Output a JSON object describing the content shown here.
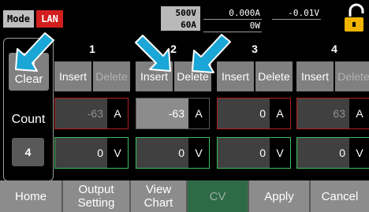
{
  "status": {
    "mode_label": "Mode",
    "interface_label": "LAN",
    "rated_voltage": "500V",
    "rated_current": "60A",
    "measured_current": "0.000A",
    "measured_voltage": "-0.01V",
    "measured_power": "0W",
    "lock_icon": "lock-open-icon"
  },
  "left_panel": {
    "all_clear_label": "All Clear",
    "count_label": "Count",
    "count_value": "4"
  },
  "columns": [
    {
      "number": "1",
      "insert": "Insert",
      "delete": "Delete",
      "current": "-63",
      "current_unit": "A",
      "voltage": "0",
      "voltage_unit": "V"
    },
    {
      "number": "2",
      "insert": "Insert",
      "delete": "Delete",
      "current": "-63",
      "current_unit": "A",
      "voltage": "0",
      "voltage_unit": "V"
    },
    {
      "number": "3",
      "insert": "Insert",
      "delete": "Delete",
      "current": "0",
      "current_unit": "A",
      "voltage": "0",
      "voltage_unit": "V"
    },
    {
      "number": "4",
      "insert": "Insert",
      "delete": "Delete",
      "current": "63",
      "current_unit": "A",
      "voltage": "0",
      "voltage_unit": "V"
    }
  ],
  "softkeys": {
    "home": "Home",
    "output_setting": "Output Setting",
    "view_chart": "View Chart",
    "cv": "CV",
    "apply": "Apply",
    "cancel": "Cancel"
  },
  "colors": {
    "lan_badge": "#d21e1e",
    "current_border": "#b02020",
    "voltage_border": "#3fbf5f",
    "active_key": "#2f6a47",
    "annotation_arrow": "#1aa6d6",
    "lock": "#f0b400"
  }
}
